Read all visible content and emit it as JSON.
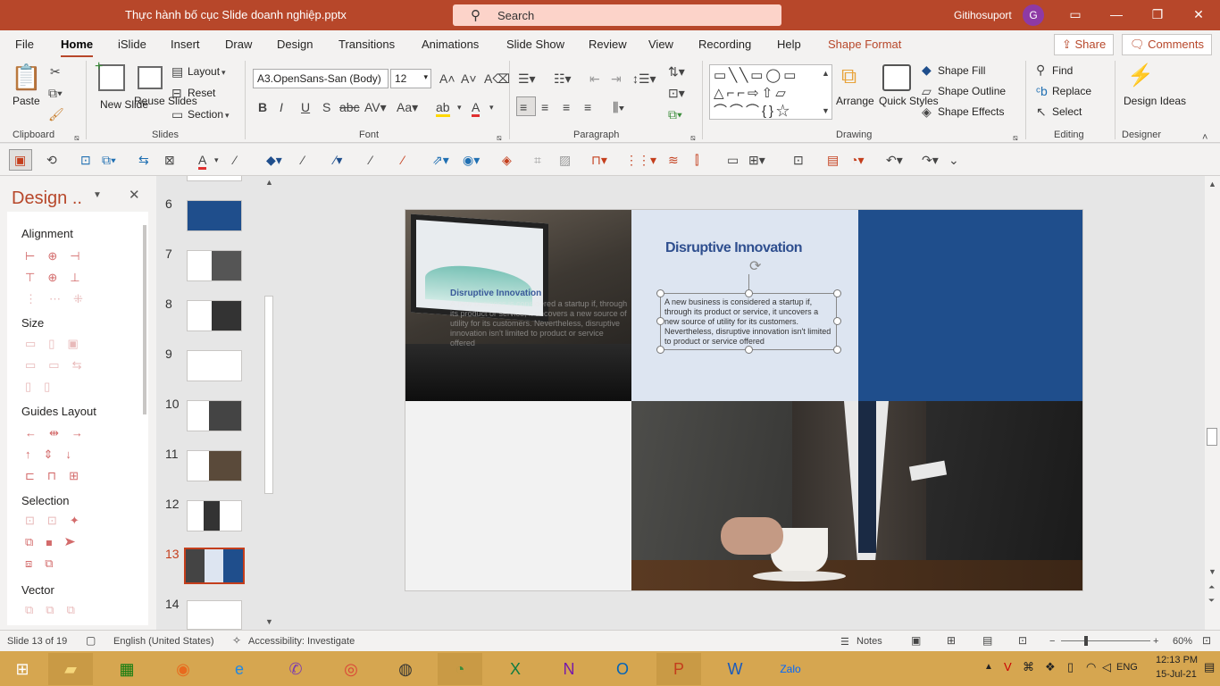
{
  "window": {
    "title": "Thực hành bố cục Slide doanh nghiệp.pptx",
    "search_placeholder": "Search",
    "user": "Gitihosuport",
    "avatar_initial": "G"
  },
  "tabs": [
    "File",
    "Home",
    "iSlide",
    "Insert",
    "Draw",
    "Design",
    "Transitions",
    "Animations",
    "Slide Show",
    "Review",
    "View",
    "Recording",
    "Help",
    "Shape Format"
  ],
  "share_label": "Share",
  "comments_label": "Comments",
  "ribbon": {
    "clipboard": {
      "paste": "Paste",
      "group": "Clipboard"
    },
    "slides": {
      "new_slide": "New Slide",
      "reuse": "Reuse Slides",
      "layout": "Layout",
      "reset": "Reset",
      "section": "Section",
      "group": "Slides"
    },
    "font": {
      "name": "A3.OpenSans-San (Body)",
      "size": "12",
      "group": "Font",
      "bold": "B",
      "italic": "I",
      "underline": "U",
      "strike": "S"
    },
    "paragraph": {
      "group": "Paragraph"
    },
    "drawing": {
      "arrange": "Arrange",
      "quick_styles": "Quick Styles",
      "shape_fill": "Shape Fill",
      "shape_outline": "Shape Outline",
      "shape_effects": "Shape Effects",
      "group": "Drawing"
    },
    "editing": {
      "find": "Find",
      "replace": "Replace",
      "select": "Select",
      "group": "Editing"
    },
    "designer": {
      "design_ideas": "Design Ideas",
      "group": "Designer"
    }
  },
  "design_pane": {
    "title": "Design ..",
    "sections": [
      "Alignment",
      "Size",
      "Guides Layout",
      "Selection",
      "Vector"
    ]
  },
  "thumbnails": [
    {
      "num": "6"
    },
    {
      "num": "7"
    },
    {
      "num": "8"
    },
    {
      "num": "9"
    },
    {
      "num": "10"
    },
    {
      "num": "11"
    },
    {
      "num": "12"
    },
    {
      "num": "13"
    },
    {
      "num": "14"
    }
  ],
  "slide": {
    "heading": "Disruptive Innovation",
    "body": "A new business is considered a startup if, through its product or service, it uncovers a new source of utility for its customers. Nevertheless, disruptive innovation isn't limited to product or service offered",
    "ghost_heading": "Disruptive Innovation",
    "ghost_body": "A new business is considered a startup if, through its product or service, it uncovers a new source of utility for its customers. Nevertheless, disruptive innovation isn't limited to product or service offered",
    "colors": {
      "light_panel": "#dde5f1",
      "blue_panel": "#1f4e8c",
      "grey_panel": "#f2f2f2",
      "heading": "#2f4f8f"
    }
  },
  "status": {
    "slide": "Slide 13 of 19",
    "language": "English (United States)",
    "accessibility": "Accessibility: Investigate",
    "notes": "Notes",
    "zoom": "60%"
  },
  "taskbar": {
    "lang": "ENG",
    "time": "12:13 PM",
    "date": "15-Jul-21"
  }
}
